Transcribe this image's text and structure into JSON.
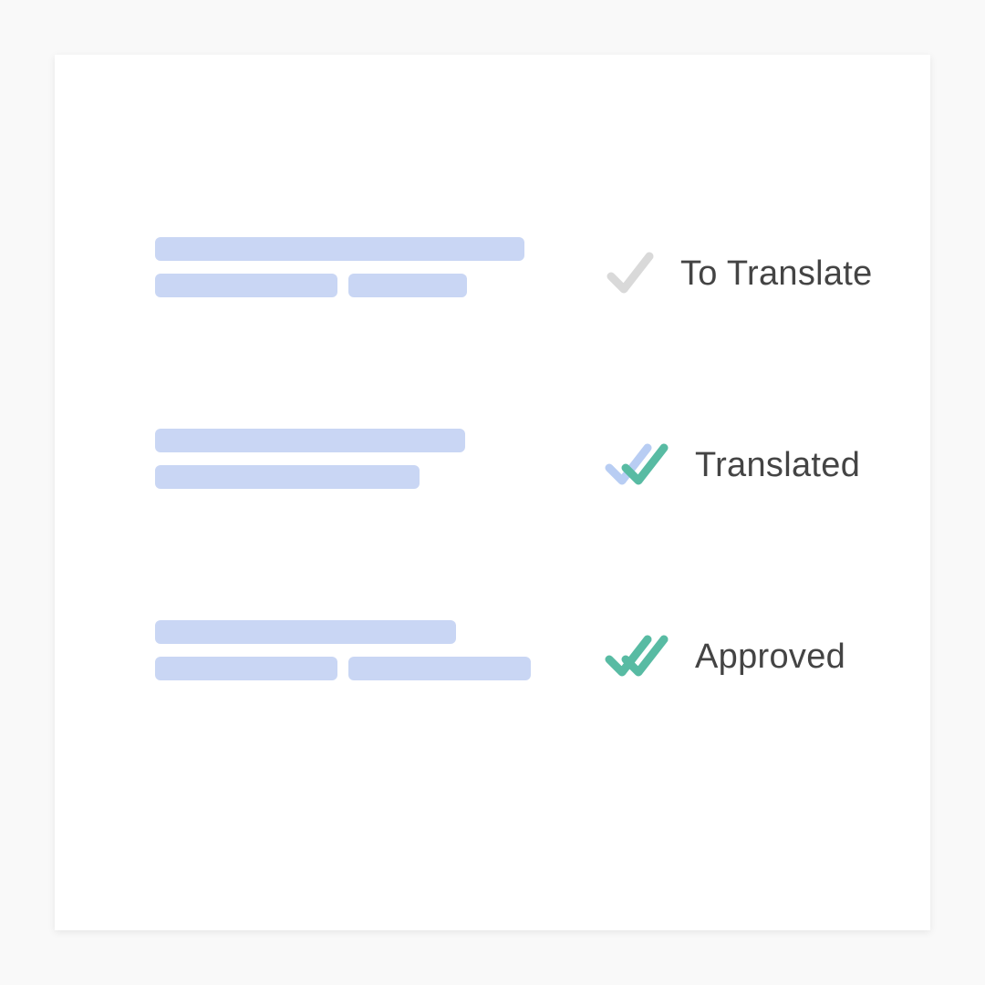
{
  "statuses": [
    {
      "label": "To Translate",
      "icon": "check-single-grey"
    },
    {
      "label": "Translated",
      "icon": "check-double-blue-teal"
    },
    {
      "label": "Approved",
      "icon": "check-double-teal"
    }
  ],
  "colors": {
    "placeholder_line": "#c9d6f4",
    "grey_check": "#d9d9d9",
    "blue_check": "#b8cdf3",
    "teal_check": "#58bba3",
    "text": "#444444",
    "card_bg": "#ffffff",
    "page_bg": "#f9f9f9"
  }
}
